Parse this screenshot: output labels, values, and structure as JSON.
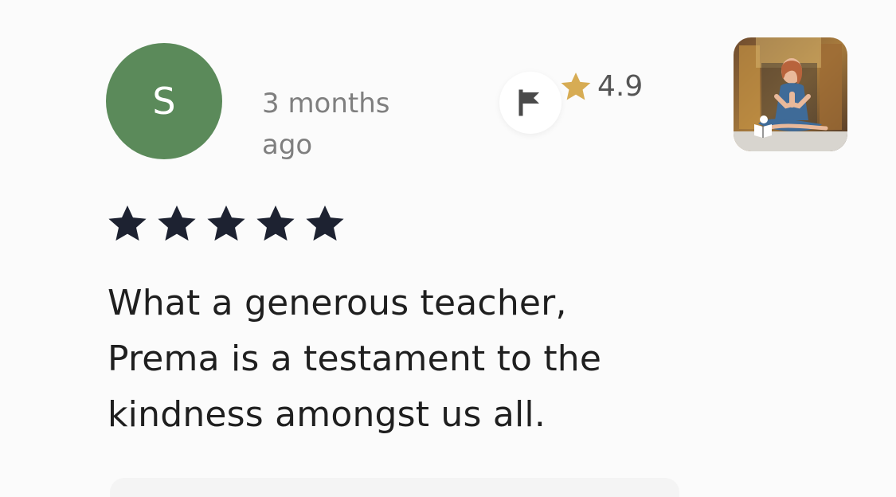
{
  "review": {
    "author_initial": "S",
    "avatar_color": "#5b8a5a",
    "timestamp": "3 months ago",
    "rating_value": "4.9",
    "star_count": 5,
    "text": "What a generous teacher, Prema is a testament to the kindness amongst us all."
  },
  "colors": {
    "gold_star": "#d7ac54",
    "dark_star": "#1d2231"
  },
  "icons": {
    "flag": "flag-icon",
    "rating_star": "star-icon",
    "thumbnail_badge": "book-reader-icon"
  }
}
